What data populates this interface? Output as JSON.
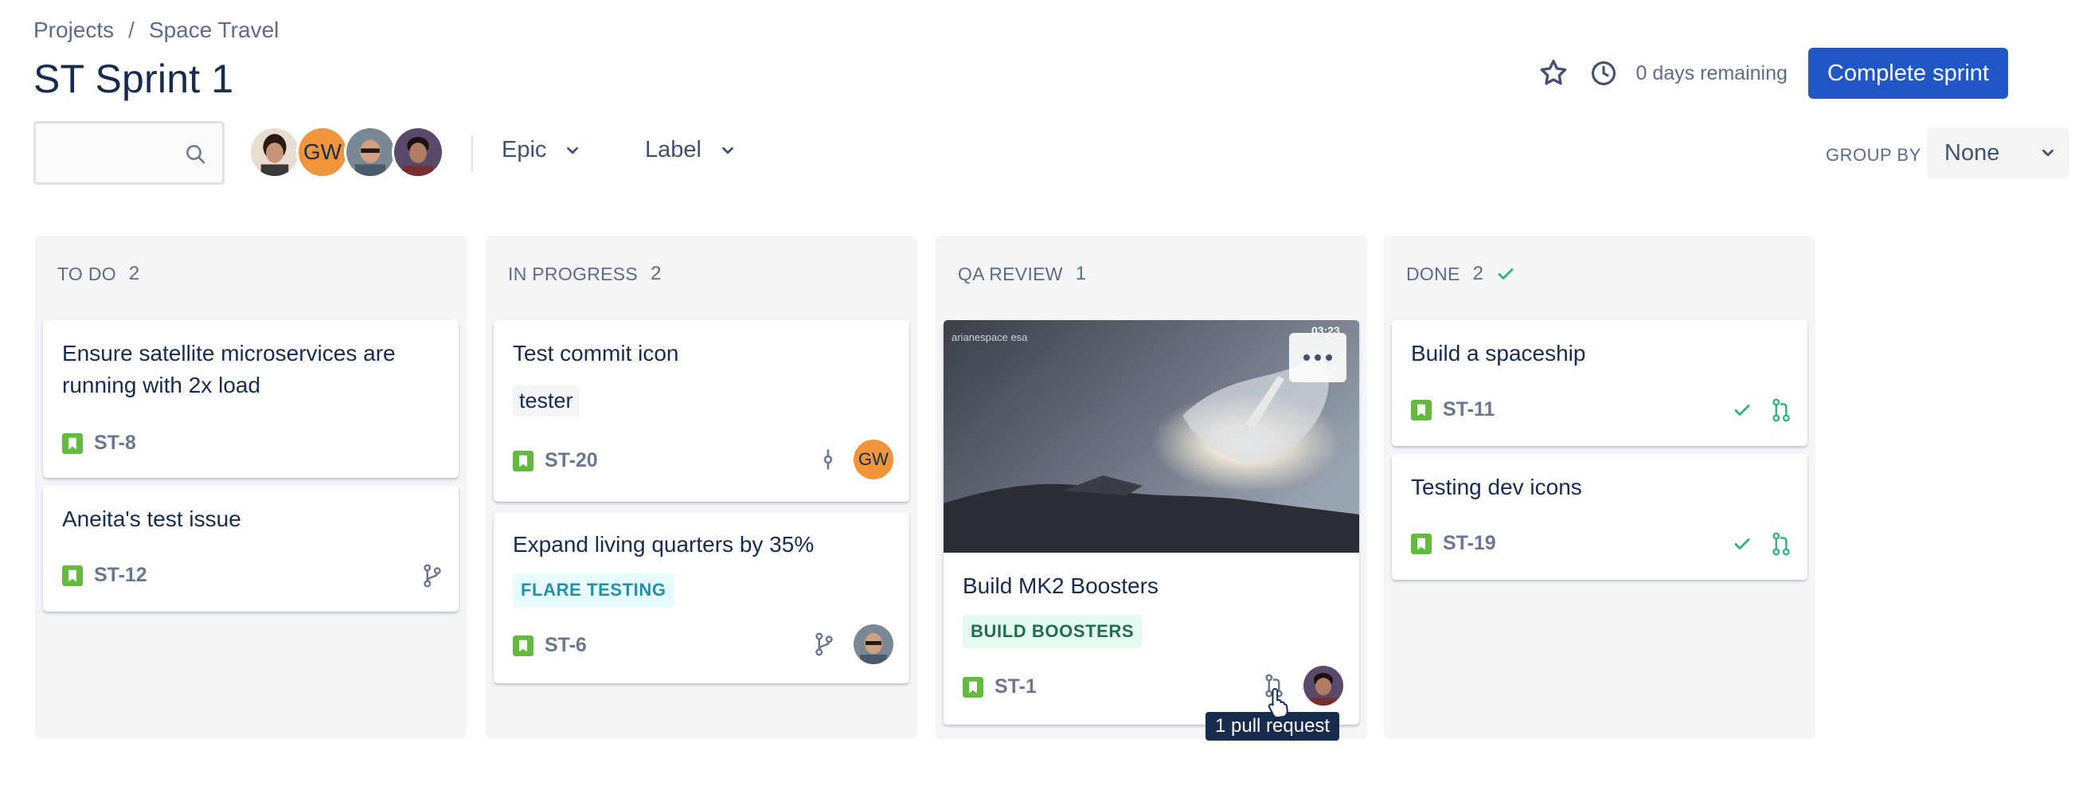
{
  "breadcrumb": {
    "items": [
      "Projects",
      "Space Travel"
    ],
    "separator": "/"
  },
  "page": {
    "title": "ST Sprint 1"
  },
  "header": {
    "days_remaining": "0 days remaining",
    "complete_label": "Complete sprint"
  },
  "search": {
    "value": "",
    "placeholder": ""
  },
  "avatars": {
    "gw_initials": "GW"
  },
  "filters": {
    "epic": "Epic",
    "label": "Label"
  },
  "group_by": {
    "label": "GROUP BY",
    "value": "None"
  },
  "columns": [
    {
      "name": "TO DO",
      "count": "2",
      "cards": [
        {
          "title": "Ensure satellite microservices are running with 2x load",
          "key": "ST-8"
        },
        {
          "title": "Aneita's test issue",
          "key": "ST-12"
        }
      ]
    },
    {
      "name": "IN PROGRESS",
      "count": "2",
      "cards": [
        {
          "title": "Test commit icon",
          "label": "tester",
          "key": "ST-20",
          "assignee_initials": "GW"
        },
        {
          "title": "Expand living quarters by 35%",
          "epic": "FLARE TESTING",
          "key": "ST-6"
        }
      ]
    },
    {
      "name": "QA REVIEW",
      "count": "1",
      "cards": [
        {
          "title": "Build MK2 Boosters",
          "epic": "BUILD BOOSTERS",
          "key": "ST-1",
          "cover_text": "arianespace   esa",
          "cover_time": "03:23"
        }
      ]
    },
    {
      "name": "DONE",
      "count": "2",
      "cards": [
        {
          "title": "Build a spaceship",
          "key": "ST-11"
        },
        {
          "title": "Testing dev icons",
          "key": "ST-19"
        }
      ]
    }
  ],
  "tooltip": {
    "text": "1 pull request"
  },
  "colors": {
    "primary": "#1f57c4",
    "story_green": "#63ba3c",
    "done_green": "#36b37e",
    "column_bg": "#f4f5f7",
    "text": "#172b4d",
    "subtle": "#5e6c84"
  }
}
